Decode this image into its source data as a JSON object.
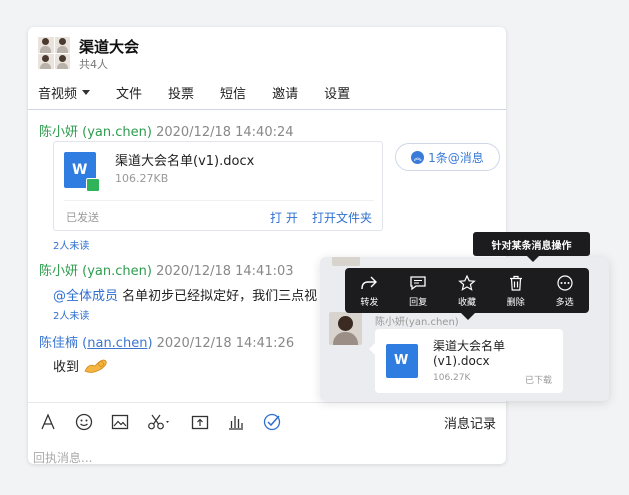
{
  "header": {
    "title": "渠道大会",
    "subtitle": "共4人",
    "tabs": [
      {
        "label": "音视频"
      },
      {
        "label": "文件"
      },
      {
        "label": "投票"
      },
      {
        "label": "短信"
      },
      {
        "label": "邀请"
      },
      {
        "label": "设置"
      }
    ]
  },
  "messages": [
    {
      "sender": "陈小妍 (yan.chen)",
      "timestamp": "2020/12/18 14:40:24",
      "file": {
        "name": "渠道大会名单(v1).docx",
        "size": "106.27KB",
        "status": "已发送",
        "open_label": "打 开",
        "open_folder_label": "打开文件夹"
      },
      "unread": "2人未读"
    },
    {
      "sender": "陈小妍 (yan.chen)",
      "timestamp": "2020/12/18 14:41:03",
      "mention": "@全体成员",
      "text": " 名单初步已经拟定好，我们三点视",
      "unread": "2人未读"
    },
    {
      "sender_name": "陈佳楠",
      "sender_id": "nan.chen",
      "timestamp": "2020/12/18 14:41:26",
      "text": "收到"
    }
  ],
  "mention_pill": {
    "label": "1条@消息"
  },
  "toolbar": {
    "history_label": "消息记录"
  },
  "reply": {
    "placeholder": "回执消息..."
  },
  "tooltip": {
    "label": "针对某条消息操作"
  },
  "context_menu": {
    "items": [
      {
        "label": "转发",
        "icon": "forward-icon"
      },
      {
        "label": "回复",
        "icon": "reply-icon"
      },
      {
        "label": "收藏",
        "icon": "star-icon"
      },
      {
        "label": "删除",
        "icon": "trash-icon"
      },
      {
        "label": "多选",
        "icon": "more-icon"
      }
    ]
  },
  "demo": {
    "sender": "陈小妍(yan.chen)",
    "file_name": "渠道大会名单(v1).docx",
    "file_size": "106.27K",
    "file_status": "已下载"
  },
  "colors": {
    "accent": "#2f6fd0",
    "green": "#2e9c4e",
    "word": "#2f7de1"
  }
}
